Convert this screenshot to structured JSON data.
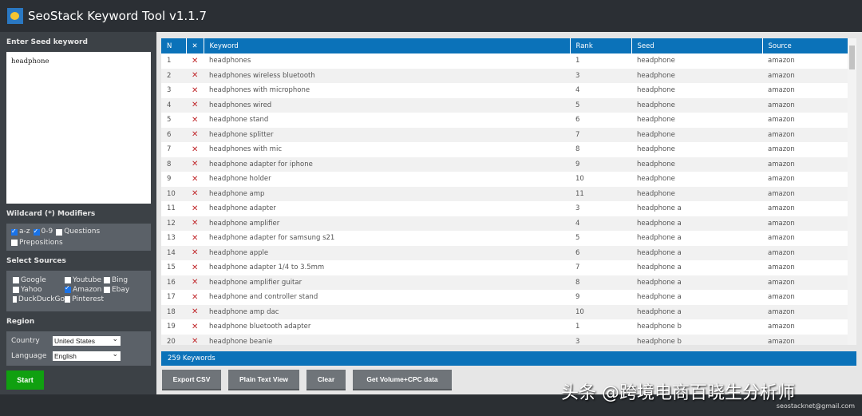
{
  "app": {
    "title": "SeoStack Keyword Tool v1.1.7"
  },
  "sidebar": {
    "seed_label": "Enter Seed keyword",
    "seed_value": "headphone",
    "wildcard_label": "Wildcard (*) Modifiers",
    "modifiers": [
      {
        "label": "a-z",
        "checked": true
      },
      {
        "label": "0-9",
        "checked": true
      },
      {
        "label": "Questions",
        "checked": false
      },
      {
        "label": "Prepositions",
        "checked": false
      }
    ],
    "sources_label": "Select Sources",
    "sources": [
      {
        "label": "Google",
        "checked": false
      },
      {
        "label": "Youtube",
        "checked": false
      },
      {
        "label": "Bing",
        "checked": false
      },
      {
        "label": "Yahoo",
        "checked": false
      },
      {
        "label": "Amazon",
        "checked": true
      },
      {
        "label": "Ebay",
        "checked": false
      },
      {
        "label": "DuckDuckGo",
        "checked": false
      },
      {
        "label": "Pinterest",
        "checked": false
      }
    ],
    "region_label": "Region",
    "country_label": "Country",
    "country_value": "United States",
    "language_label": "Language",
    "language_value": "English",
    "start_label": "Start"
  },
  "table": {
    "columns": [
      "N",
      "✕",
      "Keyword",
      "Rank",
      "Seed",
      "Source"
    ],
    "rows": [
      [
        "1",
        "headphones",
        "1",
        "headphone",
        "amazon"
      ],
      [
        "2",
        "headphones wireless bluetooth",
        "3",
        "headphone",
        "amazon"
      ],
      [
        "3",
        "headphones with microphone",
        "4",
        "headphone",
        "amazon"
      ],
      [
        "4",
        "headphones wired",
        "5",
        "headphone",
        "amazon"
      ],
      [
        "5",
        "headphone stand",
        "6",
        "headphone",
        "amazon"
      ],
      [
        "6",
        "headphone splitter",
        "7",
        "headphone",
        "amazon"
      ],
      [
        "7",
        "headphones with mic",
        "8",
        "headphone",
        "amazon"
      ],
      [
        "8",
        "headphone adapter for iphone",
        "9",
        "headphone",
        "amazon"
      ],
      [
        "9",
        "headphone holder",
        "10",
        "headphone",
        "amazon"
      ],
      [
        "10",
        "headphone amp",
        "11",
        "headphone",
        "amazon"
      ],
      [
        "11",
        "headphone adapter",
        "3",
        "headphone a",
        "amazon"
      ],
      [
        "12",
        "headphone amplifier",
        "4",
        "headphone a",
        "amazon"
      ],
      [
        "13",
        "headphone adapter for samsung s21",
        "5",
        "headphone a",
        "amazon"
      ],
      [
        "14",
        "headphone apple",
        "6",
        "headphone a",
        "amazon"
      ],
      [
        "15",
        "headphone adapter 1/4 to 3.5mm",
        "7",
        "headphone a",
        "amazon"
      ],
      [
        "16",
        "headphone amplifier guitar",
        "8",
        "headphone a",
        "amazon"
      ],
      [
        "17",
        "headphone and controller stand",
        "9",
        "headphone a",
        "amazon"
      ],
      [
        "18",
        "headphone amp dac",
        "10",
        "headphone a",
        "amazon"
      ],
      [
        "19",
        "headphone bluetooth adapter",
        "1",
        "headphone b",
        "amazon"
      ],
      [
        "20",
        "headphone beanie",
        "3",
        "headphone b",
        "amazon"
      ]
    ],
    "delete_glyph": "✕"
  },
  "status": {
    "count_text": "259 Keywords"
  },
  "buttons": {
    "export": "Export CSV",
    "plain": "Plain Text View",
    "clear": "Clear",
    "volume": "Get Volume+CPC data"
  },
  "footer": {
    "email": "seostacknet@gmail.com"
  },
  "watermark": "头条 @跨境电商百晓生分析师",
  "colors": {
    "accent": "#0b72b9",
    "start": "#10a010",
    "delete": "#c0262a"
  }
}
